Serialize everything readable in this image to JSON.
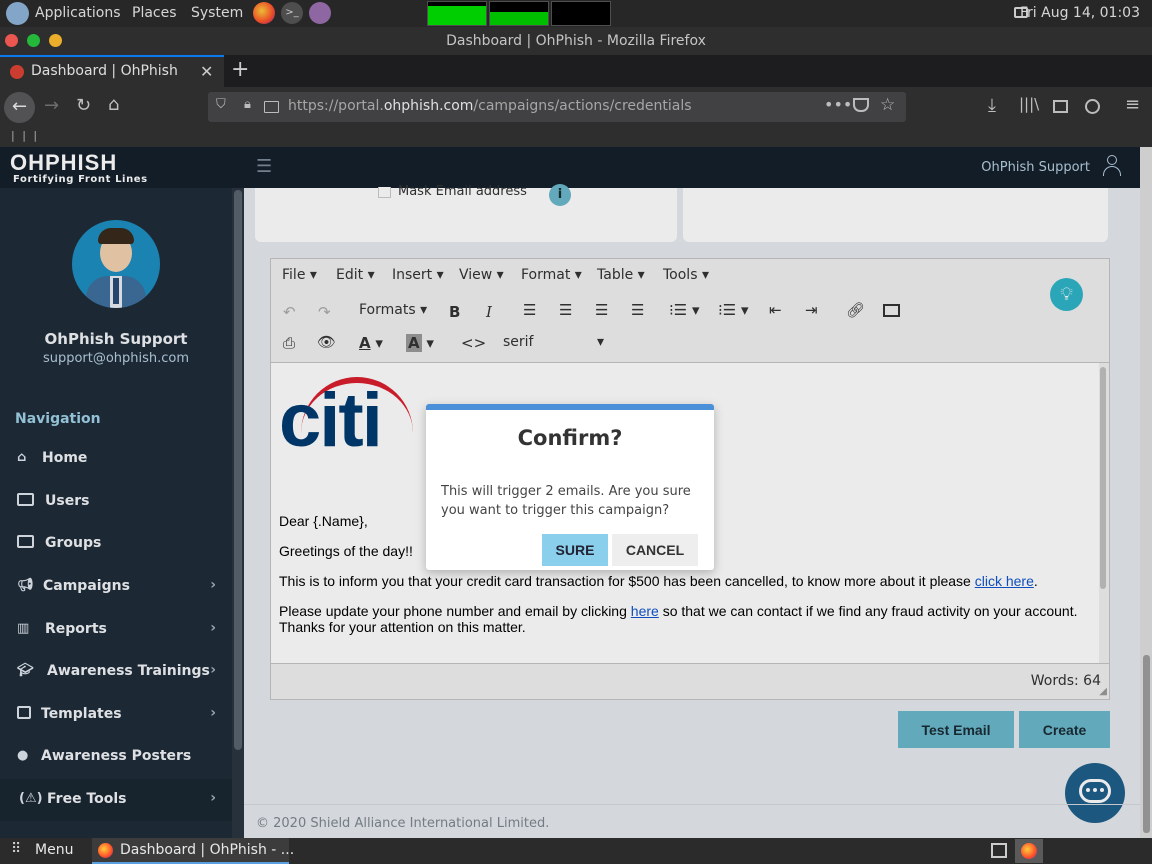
{
  "os_panel": {
    "applications": "Applications",
    "places": "Places",
    "system": "System",
    "clock": "Fri Aug 14, 01:03"
  },
  "browser": {
    "window_title": "Dashboard | OhPhish - Mozilla Firefox",
    "tab_title": "Dashboard | OhPhish",
    "url_prefix": "https://portal.",
    "url_domain": "ohphish.com",
    "url_path": "/campaigns/actions/credentials",
    "bookmarks_text": "| | |"
  },
  "header": {
    "logo_title": "OHPHISH",
    "logo_tagline": "Fortifying Front Lines",
    "support_label": "OhPhish Support"
  },
  "sidebar": {
    "user_name": "OhPhish Support",
    "user_email": "support@ohphish.com",
    "nav_heading": "Navigation",
    "items": [
      {
        "label": "Home",
        "icon": "home-icon"
      },
      {
        "label": "Users",
        "icon": "users-icon"
      },
      {
        "label": "Groups",
        "icon": "groups-icon"
      },
      {
        "label": "Campaigns",
        "icon": "megaphone-icon"
      },
      {
        "label": "Reports",
        "icon": "bar-chart-icon"
      },
      {
        "label": "Awareness Trainings",
        "icon": "graduation-cap-icon"
      },
      {
        "label": "Templates",
        "icon": "template-icon"
      },
      {
        "label": "Awareness Posters",
        "icon": "globe-icon"
      },
      {
        "label": "Free Tools",
        "icon": "tools-icon"
      }
    ]
  },
  "form": {
    "mask_email_label": "Mask Email address",
    "info_glyph": "i"
  },
  "editor": {
    "menus": [
      "File",
      "Edit",
      "Insert",
      "View",
      "Format",
      "Table",
      "Tools"
    ],
    "formats_label": "Formats",
    "font_value": "serif",
    "bold_glyph": "B",
    "italic_glyph": "I",
    "text_color_glyph": "A",
    "bg_color_glyph": "A",
    "code_glyph": "<>",
    "logo_text": "citi",
    "greeting": "Dear {.Name},",
    "line2": "Greetings of the day!!",
    "para1_text": "This is to inform you that your credit card transaction for $500 has been cancelled, to know more about it please",
    "para1_link": "click here",
    "para2_pre": "Please update your phone number and email by clicking",
    "para2_link": "here",
    "para2_post": "so that we can contact if we find any fraud activity on your account.",
    "para3": "Thanks for your attention on this matter.",
    "word_count": "Words: 64"
  },
  "actions": {
    "test_email": "Test Email",
    "create": "Create"
  },
  "footer": {
    "copyright": "© 2020 Shield Alliance International Limited."
  },
  "modal": {
    "title": "Confirm?",
    "message": "This will trigger 2 emails. Are you sure you want to trigger this campaign?",
    "sure": "SURE",
    "cancel": "CANCEL"
  },
  "taskbar": {
    "menu": "Menu",
    "window": "Dashboard | OhPhish - ..."
  },
  "colors": {
    "accent": "#4a90d9",
    "sidebar_bg": "#1f2d3a",
    "button_teal": "#6bb8cc"
  }
}
